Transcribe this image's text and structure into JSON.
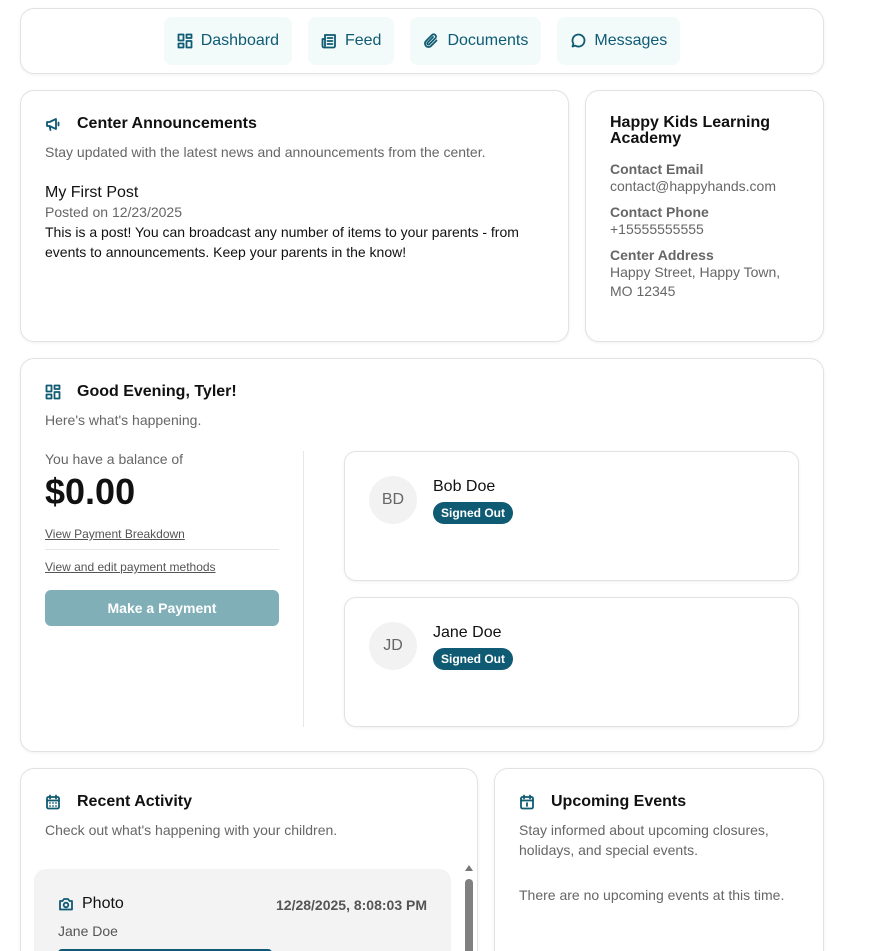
{
  "nav": {
    "items": [
      {
        "label": "Dashboard",
        "icon": "dashboard-icon"
      },
      {
        "label": "Feed",
        "icon": "newspaper-icon"
      },
      {
        "label": "Documents",
        "icon": "paperclip-icon"
      },
      {
        "label": "Messages",
        "icon": "message-bubble-icon"
      }
    ]
  },
  "announcements": {
    "title": "Center Announcements",
    "subtitle": "Stay updated with the latest news and announcements from the center.",
    "icon": "megaphone-icon",
    "post": {
      "title": "My First Post",
      "date": "Posted on 12/23/2025",
      "body": "This is a post! You can broadcast any number of items to your parents - from events to announcements. Keep your parents in the know!"
    }
  },
  "center": {
    "name": "Happy Kids Learning Academy",
    "email_label": "Contact Email",
    "email": "contact@happyhands.com",
    "phone_label": "Contact Phone",
    "phone": "+15555555555",
    "address_label": "Center Address",
    "address": "Happy Street, Happy Town, MO 12345"
  },
  "greeting": {
    "title": "Good Evening, Tyler!",
    "subtitle": "Here's what's happening.",
    "icon": "dashboard-icon"
  },
  "balance": {
    "label": "You have a balance of",
    "amount": "$0.00",
    "breakdown_link": "View Payment Breakdown",
    "methods_link": "View and edit payment methods",
    "pay_button": "Make a Payment"
  },
  "children": [
    {
      "initials": "BD",
      "name": "Bob Doe",
      "status": "Signed Out"
    },
    {
      "initials": "JD",
      "name": "Jane Doe",
      "status": "Signed Out"
    }
  ],
  "activity": {
    "title": "Recent Activity",
    "subtitle": "Check out what's happening with your children.",
    "icon": "calendar-list-icon",
    "items": [
      {
        "type": "Photo",
        "icon": "camera-icon",
        "date": "12/28/2025, 8:08:03 PM",
        "child": "Jane Doe"
      }
    ]
  },
  "events": {
    "title": "Upcoming Events",
    "subtitle": "Stay informed about upcoming closures, holidays, and special events.",
    "icon": "calendar-icon",
    "empty": "There are no upcoming events at this time."
  },
  "colors": {
    "accent": "#0f5b73",
    "nav_bg": "#f2fafa",
    "pay_button_disabled": "#80afb8"
  }
}
